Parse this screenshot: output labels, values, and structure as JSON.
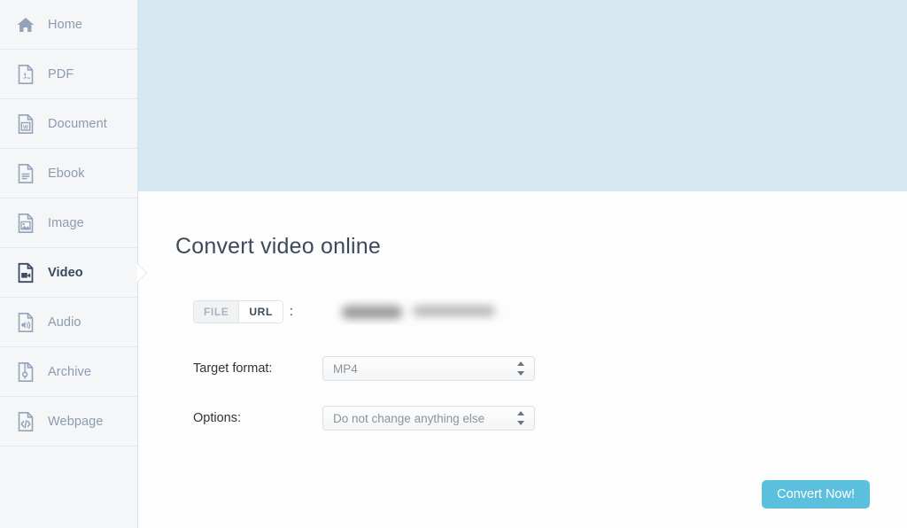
{
  "sidebar": {
    "items": [
      {
        "label": "Home",
        "icon": "home-icon",
        "active": false
      },
      {
        "label": "PDF",
        "icon": "pdf-file-icon",
        "active": false
      },
      {
        "label": "Document",
        "icon": "word-document-icon",
        "active": false
      },
      {
        "label": "Ebook",
        "icon": "ebook-file-icon",
        "active": false
      },
      {
        "label": "Image",
        "icon": "image-file-icon",
        "active": false
      },
      {
        "label": "Video",
        "icon": "video-file-icon",
        "active": true
      },
      {
        "label": "Audio",
        "icon": "audio-file-icon",
        "active": false
      },
      {
        "label": "Archive",
        "icon": "archive-zip-icon",
        "active": false
      },
      {
        "label": "Webpage",
        "icon": "webpage-code-icon",
        "active": false
      }
    ]
  },
  "main": {
    "title": "Convert video online",
    "source": {
      "file_label": "FILE",
      "url_label": "URL",
      "colon": ":",
      "selected": "URL",
      "value_redacted": true
    },
    "target_format": {
      "label": "Target format:",
      "value": "MP4"
    },
    "options": {
      "label": "Options:",
      "value": "Do not change anything else"
    },
    "convert_button": "Convert Now!"
  },
  "colors": {
    "banner": "#d5e7f1",
    "sidebar_bg": "#f5f6f7",
    "accent_button": "#5bc0de",
    "active_item": "#37485e",
    "inactive_item": "#8b9cb0"
  }
}
